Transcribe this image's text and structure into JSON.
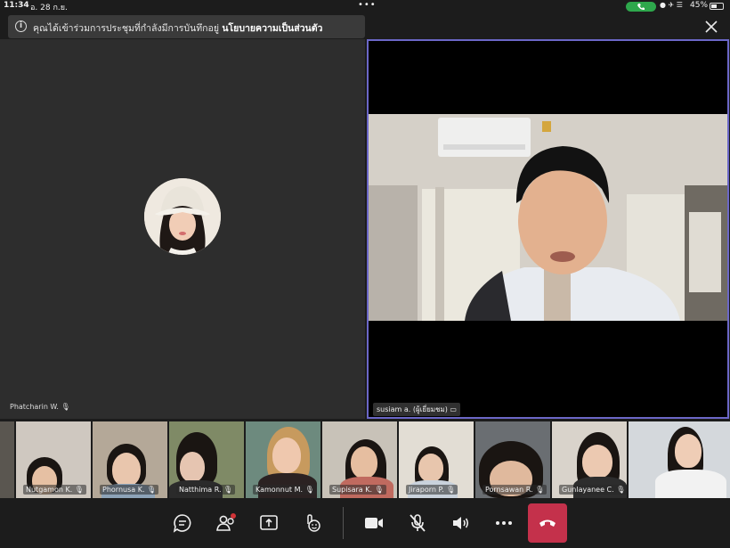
{
  "status_bar": {
    "time": "11:34",
    "date": "อ. 28 ก.ย.",
    "battery": "45%"
  },
  "banner": {
    "message": "คุณได้เข้าร่วมการประชุมที่กำลังมีการบันทึกอยู่",
    "link": "นโยบายความเป็นส่วนตัว"
  },
  "main_tiles": {
    "left_name": "Phatcharin W.",
    "right_name": "susiam a. (ผู้เยี่ยมชม)"
  },
  "participants": [
    {
      "name": "Nutgamon K."
    },
    {
      "name": "Phornusa K."
    },
    {
      "name": "Natthima R."
    },
    {
      "name": "Kamonnut M."
    },
    {
      "name": "Supisara K."
    },
    {
      "name": "Jiraporn P."
    },
    {
      "name": "Pornsawan R."
    },
    {
      "name": "Gunlayanee C."
    },
    {
      "name": ""
    }
  ],
  "colors": {
    "hangup": "#c4314b",
    "active_border": "#6b67c7",
    "call_pill": "#2ea84c"
  },
  "controls": [
    "chat-icon",
    "people-icon",
    "share-icon",
    "reactions-icon",
    "camera-icon",
    "mic-muted-icon",
    "speaker-icon",
    "more-icon",
    "hangup-icon"
  ]
}
